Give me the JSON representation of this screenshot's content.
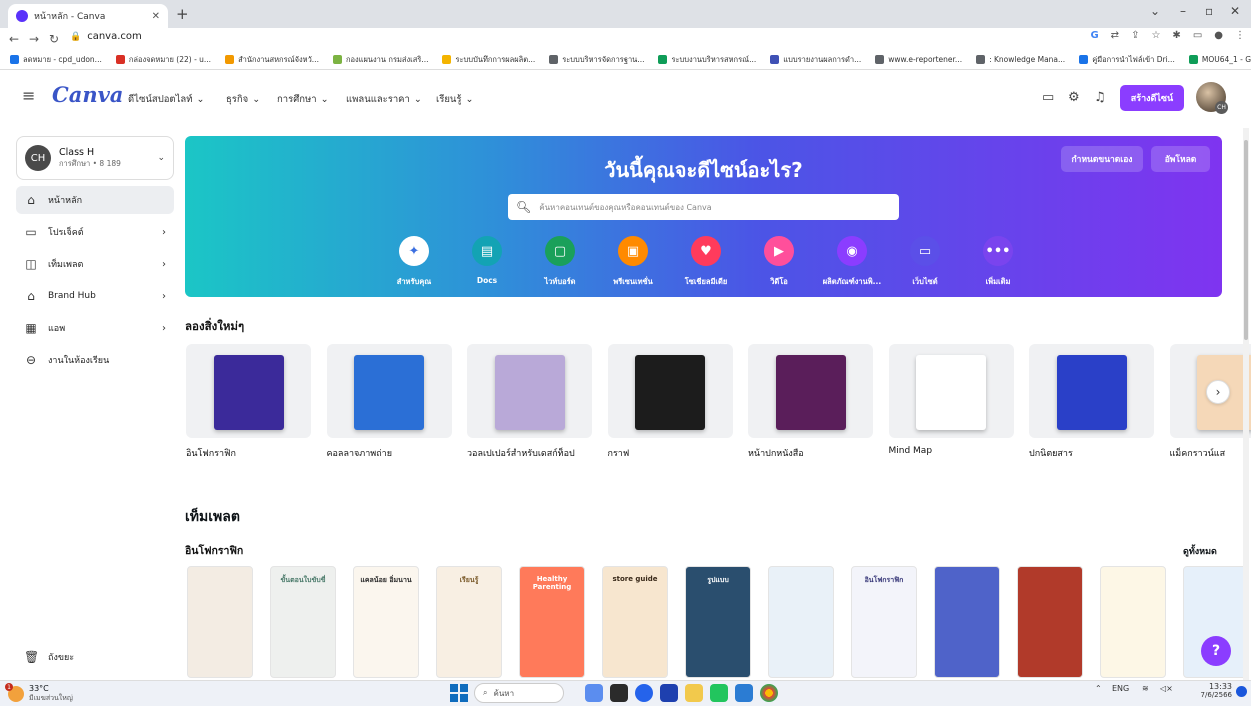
{
  "browser": {
    "tab_title": "หน้าหลัก - Canva",
    "url": "canva.com",
    "bookmarks": [
      {
        "label": "ลดหมาย - cpd_udon...",
        "color": "#1a73e8"
      },
      {
        "label": "กล่องจดหมาย (22) - u...",
        "color": "#d93025"
      },
      {
        "label": "สำนักงานสหกรณ์จังหวั...",
        "color": "#f29900"
      },
      {
        "label": "กองแผนงาน กรมส่งเสริ...",
        "color": "#7cb342"
      },
      {
        "label": "ระบบบันทึกการผลผลิต...",
        "color": "#f4b400"
      },
      {
        "label": "ระบบบริหารจัดการฐาน...",
        "color": "#5f6368"
      },
      {
        "label": "ระบบงานบริหารสหกรณ์...",
        "color": "#0f9d58"
      },
      {
        "label": "แบบรายงานผลการดำ...",
        "color": "#3f51b5"
      },
      {
        "label": "www.e-reportener...",
        "color": "#5f6368"
      },
      {
        "label": ": Knowledge Mana...",
        "color": "#5f6368"
      },
      {
        "label": "คู่มือการนำไฟล์เข้า Dri...",
        "color": "#1a73e8"
      },
      {
        "label": "MOU64_1 - Google...",
        "color": "#0f9d58"
      }
    ]
  },
  "header": {
    "logo": "Canva",
    "menu": [
      "ดีไซน์สปอตไลท์",
      "ธุรกิจ",
      "การศึกษา",
      "แพลนและราคา",
      "เรียนรู้"
    ],
    "create_button": "สร้างดีไซน์",
    "avatar_initials": "CH"
  },
  "sidebar": {
    "account": {
      "initials": "CH",
      "name": "Class H",
      "sub": "การศึกษา • 8 189"
    },
    "items": [
      {
        "label": "หน้าหลัก",
        "icon": "home-icon",
        "active": true,
        "arrow": false
      },
      {
        "label": "โปรเจ็คต์",
        "icon": "folder-icon",
        "active": false,
        "arrow": true
      },
      {
        "label": "เท็มเพลต",
        "icon": "template-icon",
        "active": false,
        "arrow": true
      },
      {
        "label": "Brand Hub",
        "icon": "brand-icon",
        "active": false,
        "arrow": true
      },
      {
        "label": "แอพ",
        "icon": "apps-icon",
        "active": false,
        "arrow": true
      },
      {
        "label": "งานในห้องเรียน",
        "icon": "classroom-icon",
        "active": false,
        "arrow": false
      }
    ],
    "trash": "ถังขยะ"
  },
  "hero": {
    "title": "วันนี้คุณจะดีไซน์อะไร?",
    "custom_size_button": "กำหนดขนาดเอง",
    "upload_button": "อัพโหลด",
    "search_placeholder": "ค้นหาคอนเทนต์ของคุณหรือคอนเทนต์ของ Canva",
    "categories": [
      {
        "label": "สำหรับคุณ",
        "color": "#ffffff",
        "fg": "#3b6fe0",
        "icon": "✦"
      },
      {
        "label": "Docs",
        "color": "#13a3b4",
        "fg": "#fff",
        "icon": "▤"
      },
      {
        "label": "ไวท์บอร์ด",
        "color": "#1aa05a",
        "fg": "#fff",
        "icon": "▢"
      },
      {
        "label": "พรีเซนเทชั่น",
        "color": "#ff8a00",
        "fg": "#fff",
        "icon": "▣"
      },
      {
        "label": "โซเชียลมีเดีย",
        "color": "#ff3b5c",
        "fg": "#fff",
        "icon": "♥"
      },
      {
        "label": "วิดีโอ",
        "color": "#ff4f9b",
        "fg": "#fff",
        "icon": "▶"
      },
      {
        "label": "ผลิตภัณฑ์งานพิ...",
        "color": "#8b3dff",
        "fg": "#fff",
        "icon": "◉"
      },
      {
        "label": "เว็บไซต์",
        "color": "#5b4fe8",
        "fg": "#fff",
        "icon": "▭"
      },
      {
        "label": "เพิ่มเติม",
        "color": "#7a44ee",
        "fg": "#fff",
        "icon": "•••"
      }
    ]
  },
  "try_new": {
    "title": "ลองสิ่งใหม่ๆ",
    "cards": [
      {
        "label": "อินโฟกราฟิก",
        "bg": "#3b2a9a"
      },
      {
        "label": "คอลลาจภาพถ่าย",
        "bg": "#2b6fd6"
      },
      {
        "label": "วอลเปเปอร์สำหรับเดสก์ท็อป",
        "bg": "#b9a9d8"
      },
      {
        "label": "กราฟ",
        "bg": "#1c1c1c"
      },
      {
        "label": "หน้าปกหนังสือ",
        "bg": "#5a1e5a"
      },
      {
        "label": "Mind Map",
        "bg": "#ffffff"
      },
      {
        "label": "ปกนิตยสาร",
        "bg": "#2a40c8"
      },
      {
        "label": "แม็คกราวน์แส",
        "bg": "#f5d8b8"
      }
    ]
  },
  "templates": {
    "title": "เท็มเพลต",
    "sub": "อินโฟกราฟิก",
    "see_all": "ดูทั้งหมด",
    "items": [
      {
        "bg": "#f3ece3",
        "fg": "#6a4b3a",
        "t": ""
      },
      {
        "bg": "#eef0ee",
        "fg": "#4a7a6a",
        "t": "ขั้นตอนใบขับขี่"
      },
      {
        "bg": "#fbf6ee",
        "fg": "#2b2b2b",
        "t": "แคลน้อย อิ่มนาน"
      },
      {
        "bg": "#f8efe3",
        "fg": "#7a5a2a",
        "t": "เรียนรู้"
      },
      {
        "bg": "#ff7a5a",
        "fg": "#fff",
        "t": "Healthy Parenting"
      },
      {
        "bg": "#f7e6cf",
        "fg": "#3a2a1a",
        "t": "store guide"
      },
      {
        "bg": "#2a4e6e",
        "fg": "#fff",
        "t": "รูปแบบ"
      },
      {
        "bg": "#e9f1f8",
        "fg": "#2a4a7a",
        "t": ""
      },
      {
        "bg": "#f3f4fa",
        "fg": "#3a3a7a",
        "t": "อินโฟกราฟิก"
      },
      {
        "bg": "#4f63c9",
        "fg": "#fff",
        "t": ""
      },
      {
        "bg": "#b13a2a",
        "fg": "#fff",
        "t": ""
      },
      {
        "bg": "#fdf7e6",
        "fg": "#c0392b",
        "t": ""
      },
      {
        "bg": "#e6f0fa",
        "fg": "#2a5a9a",
        "t": ""
      }
    ]
  },
  "help_label": "?",
  "taskbar": {
    "weather_temp": "33°C",
    "weather_desc": "มีเมฆส่วนใหญ่",
    "search": "ค้นหา",
    "lang": "ENG",
    "time": "13:33",
    "date": "7/6/2566"
  }
}
